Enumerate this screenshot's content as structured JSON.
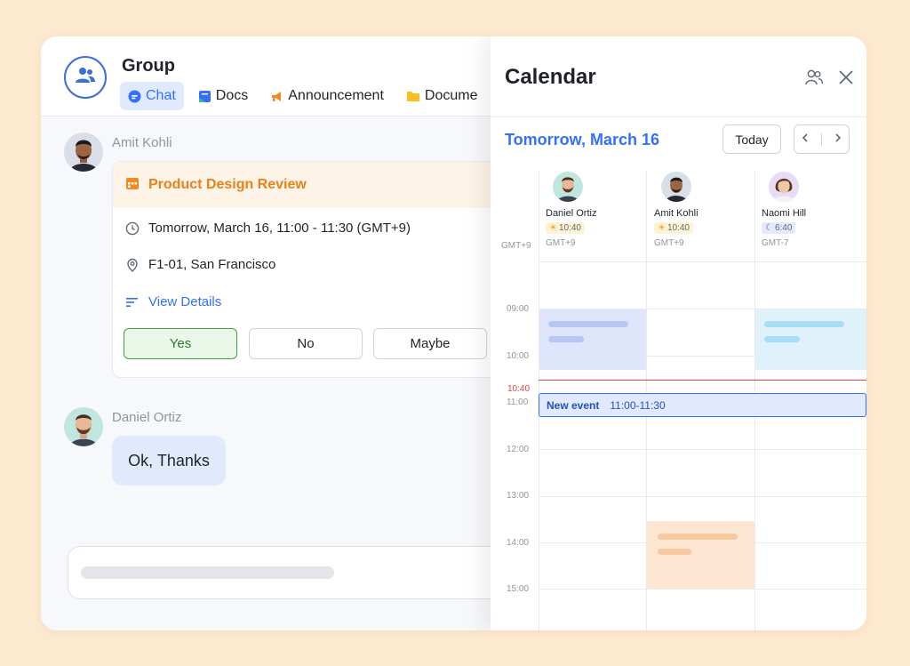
{
  "chat": {
    "group_title": "Group",
    "tabs": [
      {
        "label": "Chat",
        "icon": "chat-bubble-icon",
        "active": true
      },
      {
        "label": "Docs",
        "icon": "docs-icon"
      },
      {
        "label": "Announcement",
        "icon": "megaphone-icon"
      },
      {
        "label": "Docume",
        "icon": "folder-icon"
      }
    ],
    "messages": [
      {
        "sender": "Amit Kohli"
      },
      {
        "sender": "Daniel Ortiz",
        "text": "Ok, Thanks"
      }
    ],
    "event_card": {
      "title": "Product Design Review",
      "time": "Tomorrow, March 16, 11:00 - 11:30 (GMT+9)",
      "location": "F1-01, San Francisco",
      "view_details": "View Details",
      "rsvp": {
        "yes": "Yes",
        "no": "No",
        "maybe": "Maybe"
      }
    }
  },
  "calendar": {
    "title": "Calendar",
    "date_label": "Tomorrow, March 16",
    "today_button": "Today",
    "timezone_label": "GMT+9",
    "people": [
      {
        "name": "Daniel Ortiz",
        "local_time": "10:40",
        "tz": "GMT+9",
        "time_icon": "sun-icon"
      },
      {
        "name": "Amit Kohli",
        "local_time": "10:40",
        "tz": "GMT+9",
        "time_icon": "sun-icon"
      },
      {
        "name": "Naomi Hill",
        "local_time": "6:40",
        "tz": "GMT-7",
        "time_icon": "moon-icon"
      }
    ],
    "hours": [
      "09:00",
      "10:00",
      "11:00",
      "12:00",
      "13:00",
      "14:00",
      "15:00"
    ],
    "current_time": "10:40",
    "new_event": {
      "title": "New event",
      "time": "11:00-11:30"
    }
  },
  "colors": {
    "accent": "#3370ff",
    "orange": "#e8811a",
    "now_line": "#e54545",
    "yes_green": "#43a047",
    "background": "#fde9cf"
  }
}
